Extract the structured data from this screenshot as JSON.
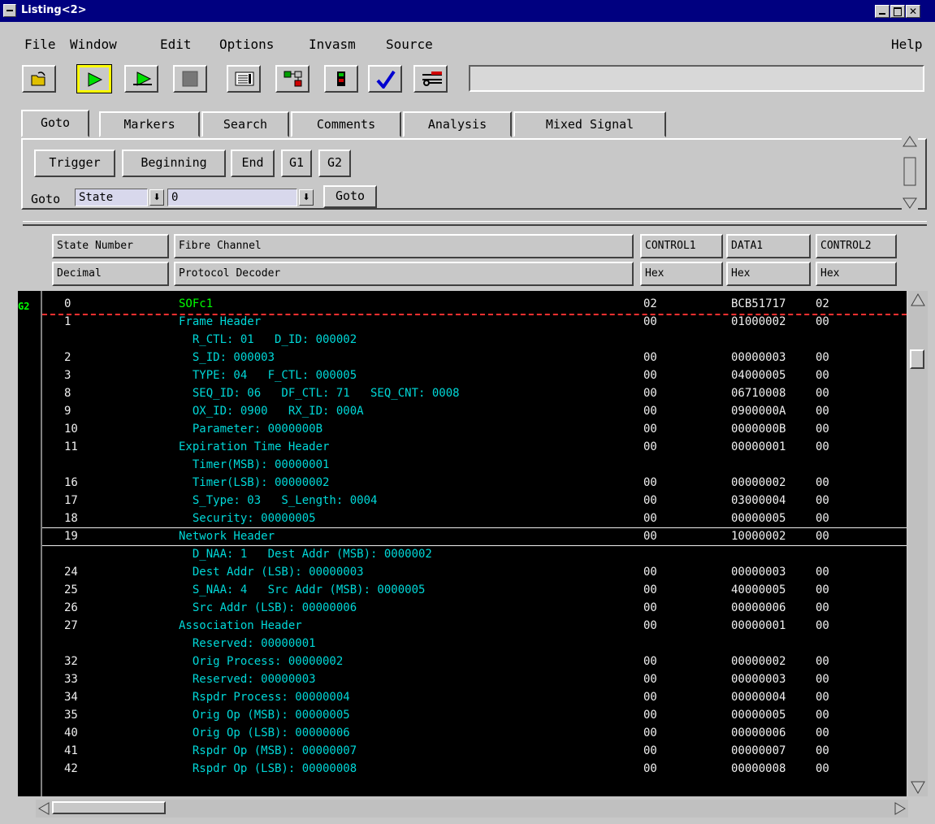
{
  "window": {
    "title": "Listing<2>"
  },
  "menu": {
    "file": "File",
    "window": "Window",
    "edit": "Edit",
    "options": "Options",
    "invasm": "Invasm",
    "source": "Source",
    "help": "Help"
  },
  "toolbar": {
    "icons": [
      "open-folder-icon",
      "run-icon",
      "run-repetitive-icon",
      "stop-icon",
      "list-icon",
      "network-icon",
      "module-icon",
      "check-icon",
      "tools-icon"
    ],
    "message": ""
  },
  "tabs": [
    "Goto",
    "Markers",
    "Search",
    "Comments",
    "Analysis",
    "Mixed Signal"
  ],
  "goto": {
    "buttons": {
      "trigger": "Trigger",
      "beginning": "Beginning",
      "end": "End",
      "g1": "G1",
      "g2": "G2"
    },
    "goto_label": "Goto",
    "type_value": "State",
    "value": "0",
    "goto_button": "Goto"
  },
  "columns": [
    {
      "name": "State Number",
      "base": "Decimal"
    },
    {
      "name": "Fibre Channel",
      "base": "Protocol Decoder"
    },
    {
      "name": "CONTROL1",
      "base": "Hex"
    },
    {
      "name": "DATA1",
      "base": "Hex"
    },
    {
      "name": "CONTROL2",
      "base": "Hex"
    }
  ],
  "marker_label": "G2",
  "colors": {
    "listing_bg": "#000000",
    "decode_text": "#00d8d8",
    "marker": "#00ff00",
    "marker_line": "#ff3030"
  },
  "rows": [
    {
      "state": "0",
      "decode": "SOFc1",
      "ctl1": "02",
      "data": "BCB51717",
      "ctl2": "02",
      "marker": true
    },
    {
      "state": "1",
      "decode": "Frame Header",
      "ctl1": "00",
      "data": "01000002",
      "ctl2": "00"
    },
    {
      "state": "",
      "decode": "  R_CTL: 01   D_ID: 000002",
      "ctl1": "",
      "data": "",
      "ctl2": ""
    },
    {
      "state": "2",
      "decode": "  S_ID: 000003",
      "ctl1": "00",
      "data": "00000003",
      "ctl2": "00"
    },
    {
      "state": "3",
      "decode": "  TYPE: 04   F_CTL: 000005",
      "ctl1": "00",
      "data": "04000005",
      "ctl2": "00"
    },
    {
      "state": "8",
      "decode": "  SEQ_ID: 06   DF_CTL: 71   SEQ_CNT: 0008",
      "ctl1": "00",
      "data": "06710008",
      "ctl2": "00"
    },
    {
      "state": "9",
      "decode": "  OX_ID: 0900   RX_ID: 000A",
      "ctl1": "00",
      "data": "0900000A",
      "ctl2": "00"
    },
    {
      "state": "10",
      "decode": "  Parameter: 0000000B",
      "ctl1": "00",
      "data": "0000000B",
      "ctl2": "00"
    },
    {
      "state": "11",
      "decode": "Expiration Time Header",
      "ctl1": "00",
      "data": "00000001",
      "ctl2": "00"
    },
    {
      "state": "",
      "decode": "  Timer(MSB): 00000001",
      "ctl1": "",
      "data": "",
      "ctl2": ""
    },
    {
      "state": "16",
      "decode": "  Timer(LSB): 00000002",
      "ctl1": "00",
      "data": "00000002",
      "ctl2": "00"
    },
    {
      "state": "17",
      "decode": "  S_Type: 03   S_Length: 0004",
      "ctl1": "00",
      "data": "03000004",
      "ctl2": "00"
    },
    {
      "state": "18",
      "decode": "  Security: 00000005",
      "ctl1": "00",
      "data": "00000005",
      "ctl2": "00"
    },
    {
      "state": "19",
      "decode": "Network Header",
      "ctl1": "00",
      "data": "10000002",
      "ctl2": "00",
      "selected": true
    },
    {
      "state": "",
      "decode": "  D_NAA: 1   Dest Addr (MSB): 0000002",
      "ctl1": "",
      "data": "",
      "ctl2": ""
    },
    {
      "state": "24",
      "decode": "  Dest Addr (LSB): 00000003",
      "ctl1": "00",
      "data": "00000003",
      "ctl2": "00"
    },
    {
      "state": "25",
      "decode": "  S_NAA: 4   Src Addr (MSB): 0000005",
      "ctl1": "00",
      "data": "40000005",
      "ctl2": "00"
    },
    {
      "state": "26",
      "decode": "  Src Addr (LSB): 00000006",
      "ctl1": "00",
      "data": "00000006",
      "ctl2": "00"
    },
    {
      "state": "27",
      "decode": "Association Header",
      "ctl1": "00",
      "data": "00000001",
      "ctl2": "00"
    },
    {
      "state": "",
      "decode": "  Reserved: 00000001",
      "ctl1": "",
      "data": "",
      "ctl2": ""
    },
    {
      "state": "32",
      "decode": "  Orig Process: 00000002",
      "ctl1": "00",
      "data": "00000002",
      "ctl2": "00"
    },
    {
      "state": "33",
      "decode": "  Reserved: 00000003",
      "ctl1": "00",
      "data": "00000003",
      "ctl2": "00"
    },
    {
      "state": "34",
      "decode": "  Rspdr Process: 00000004",
      "ctl1": "00",
      "data": "00000004",
      "ctl2": "00"
    },
    {
      "state": "35",
      "decode": "  Orig Op (MSB): 00000005",
      "ctl1": "00",
      "data": "00000005",
      "ctl2": "00"
    },
    {
      "state": "40",
      "decode": "  Orig Op (LSB): 00000006",
      "ctl1": "00",
      "data": "00000006",
      "ctl2": "00"
    },
    {
      "state": "41",
      "decode": "  Rspdr Op (MSB): 00000007",
      "ctl1": "00",
      "data": "00000007",
      "ctl2": "00"
    },
    {
      "state": "42",
      "decode": "  Rspdr Op (LSB): 00000008",
      "ctl1": "00",
      "data": "00000008",
      "ctl2": "00"
    }
  ]
}
